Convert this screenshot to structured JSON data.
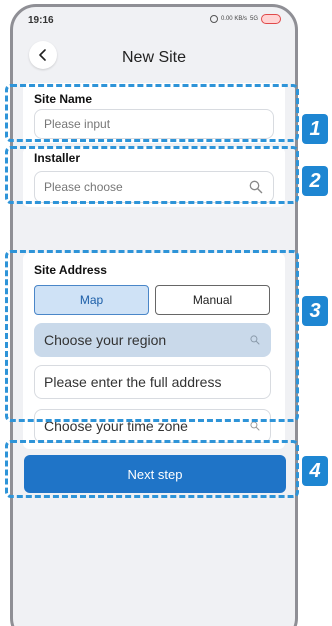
{
  "status_bar": {
    "time": "19:16",
    "net_speed": "0.00 KB/s",
    "signal": "5G"
  },
  "header": {
    "title": "New Site",
    "back_icon": "chevron-left-icon"
  },
  "site_name": {
    "label": "Site Name",
    "placeholder": "Please input"
  },
  "installer": {
    "label": "Installer",
    "placeholder": "Please choose",
    "icon": "search-icon"
  },
  "site_address": {
    "label": "Site Address",
    "tabs": [
      {
        "label": "Map",
        "selected": true
      },
      {
        "label": "Manual",
        "selected": false
      }
    ],
    "region_placeholder": "Choose your region",
    "address_placeholder": "Please enter the full address",
    "timezone_placeholder": "Choose your time zone"
  },
  "next_button": {
    "label": "Next step"
  },
  "annotations": [
    "1",
    "2",
    "3",
    "4"
  ],
  "colors": {
    "accent": "#1f74c7",
    "highlight": "#2e94d8",
    "selected_tab_bg": "#cfe2f6",
    "region_field_bg": "#c9d9ea"
  }
}
